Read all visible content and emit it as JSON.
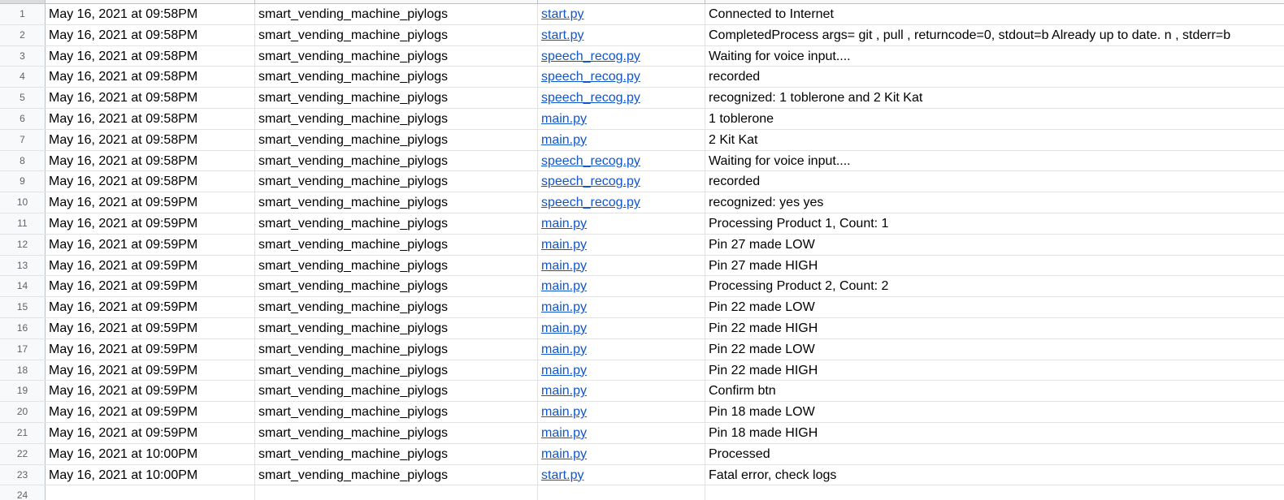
{
  "rows": [
    {
      "num": "1",
      "date": "May 16, 2021 at 09:58PM",
      "source": "smart_vending_machine_piylogs",
      "file": "start.py",
      "message": "Connected to Internet"
    },
    {
      "num": "2",
      "date": "May 16, 2021 at 09:58PM",
      "source": "smart_vending_machine_piylogs",
      "file": "start.py",
      "message": "CompletedProcess args=  git ,  pull  , returncode=0, stdout=b Already up to date. n , stderr=b"
    },
    {
      "num": "3",
      "date": "May 16, 2021 at 09:58PM",
      "source": "smart_vending_machine_piylogs",
      "file": "speech_recog.py",
      "message": "Waiting for voice input...."
    },
    {
      "num": "4",
      "date": "May 16, 2021 at 09:58PM",
      "source": "smart_vending_machine_piylogs",
      "file": "speech_recog.py",
      "message": "recorded"
    },
    {
      "num": "5",
      "date": "May 16, 2021 at 09:58PM",
      "source": "smart_vending_machine_piylogs",
      "file": "speech_recog.py",
      "message": "recognized: 1 toblerone and 2 Kit Kat"
    },
    {
      "num": "6",
      "date": "May 16, 2021 at 09:58PM",
      "source": "smart_vending_machine_piylogs",
      "file": "main.py",
      "message": "1 toblerone"
    },
    {
      "num": "7",
      "date": "May 16, 2021 at 09:58PM",
      "source": "smart_vending_machine_piylogs",
      "file": "main.py",
      "message": "2 Kit Kat"
    },
    {
      "num": "8",
      "date": "May 16, 2021 at 09:58PM",
      "source": "smart_vending_machine_piylogs",
      "file": "speech_recog.py",
      "message": "Waiting for voice input...."
    },
    {
      "num": "9",
      "date": "May 16, 2021 at 09:58PM",
      "source": "smart_vending_machine_piylogs",
      "file": "speech_recog.py",
      "message": "recorded"
    },
    {
      "num": "10",
      "date": "May 16, 2021 at 09:59PM",
      "source": "smart_vending_machine_piylogs",
      "file": "speech_recog.py",
      "message": "recognized: yes yes"
    },
    {
      "num": "11",
      "date": "May 16, 2021 at 09:59PM",
      "source": "smart_vending_machine_piylogs",
      "file": "main.py",
      "message": "Processing Product 1, Count: 1"
    },
    {
      "num": "12",
      "date": "May 16, 2021 at 09:59PM",
      "source": "smart_vending_machine_piylogs",
      "file": "main.py",
      "message": "Pin 27 made LOW"
    },
    {
      "num": "13",
      "date": "May 16, 2021 at 09:59PM",
      "source": "smart_vending_machine_piylogs",
      "file": "main.py",
      "message": "Pin 27 made HIGH"
    },
    {
      "num": "14",
      "date": "May 16, 2021 at 09:59PM",
      "source": "smart_vending_machine_piylogs",
      "file": "main.py",
      "message": "Processing Product 2, Count: 2"
    },
    {
      "num": "15",
      "date": "May 16, 2021 at 09:59PM",
      "source": "smart_vending_machine_piylogs",
      "file": "main.py",
      "message": "Pin 22 made LOW"
    },
    {
      "num": "16",
      "date": "May 16, 2021 at 09:59PM",
      "source": "smart_vending_machine_piylogs",
      "file": "main.py",
      "message": "Pin 22 made HIGH"
    },
    {
      "num": "17",
      "date": "May 16, 2021 at 09:59PM",
      "source": "smart_vending_machine_piylogs",
      "file": "main.py",
      "message": "Pin 22 made LOW"
    },
    {
      "num": "18",
      "date": "May 16, 2021 at 09:59PM",
      "source": "smart_vending_machine_piylogs",
      "file": "main.py",
      "message": "Pin 22 made HIGH"
    },
    {
      "num": "19",
      "date": "May 16, 2021 at 09:59PM",
      "source": "smart_vending_machine_piylogs",
      "file": "main.py",
      "message": "Confirm btn"
    },
    {
      "num": "20",
      "date": "May 16, 2021 at 09:59PM",
      "source": "smart_vending_machine_piylogs",
      "file": "main.py",
      "message": "Pin 18 made LOW"
    },
    {
      "num": "21",
      "date": "May 16, 2021 at 09:59PM",
      "source": "smart_vending_machine_piylogs",
      "file": "main.py",
      "message": "Pin 18 made HIGH"
    },
    {
      "num": "22",
      "date": "May 16, 2021 at 10:00PM",
      "source": "smart_vending_machine_piylogs",
      "file": "main.py",
      "message": "Processed"
    },
    {
      "num": "23",
      "date": "May 16, 2021 at 10:00PM",
      "source": "smart_vending_machine_piylogs",
      "file": "start.py",
      "message": "Fatal error, check logs"
    },
    {
      "num": "24",
      "date": "",
      "source": "",
      "file": "",
      "message": ""
    }
  ],
  "colors": {
    "link": "#1155cc",
    "header_bg": "#f8f9fa",
    "grid_line": "#e2e2e2",
    "header_line": "#c0c0c0",
    "row_number_text": "#5f6368"
  }
}
